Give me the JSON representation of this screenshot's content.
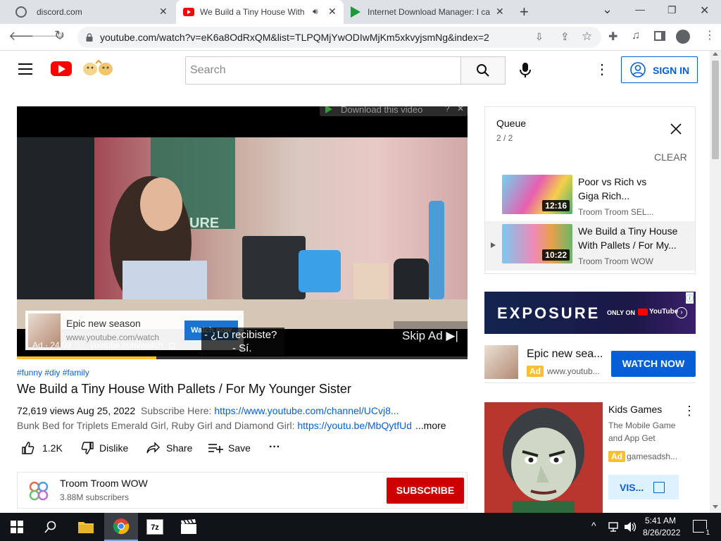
{
  "tabs": [
    {
      "title": "discord.com",
      "close": "✕"
    },
    {
      "title": "We Build a Tiny House With",
      "close": "✕"
    },
    {
      "title": "Internet Download Manager: I ca",
      "close": "✕"
    }
  ],
  "new_tab": "+",
  "window": {
    "minimize": "—",
    "restore": "❐",
    "close": "✕",
    "tablist": "⌄"
  },
  "address": {
    "url": "youtube.com/watch?v=eK6a8OdRxQM&list=TLPQMjYwODIwMjKm5xkvyjsmNg&index=2"
  },
  "yt": {
    "search_placeholder": "Search",
    "sign_in": "SIGN IN"
  },
  "idm": {
    "download_label": "Download this video",
    "help": "?",
    "close": "✕"
  },
  "ad_overlay": {
    "title": "Epic new season",
    "url": "www.youtube.com/watch",
    "cta": "Watch now"
  },
  "skip_ad": "Skip Ad ▶|",
  "player_bar": {
    "ad_time": "Ad · 24:09",
    "info": "ⓘ",
    "url": "youtube.com/watch"
  },
  "captions": [
    "- ¿Lo recibiste?",
    "- Sí."
  ],
  "progress_fraction": 0.31,
  "video_info": {
    "hashtags": "#funny #diy #family",
    "title": "We Build a Tiny House With Pallets / For My Younger Sister",
    "views_date": "72,619 views  Aug 25, 2022",
    "subscribe_here": "Subscribe Here:",
    "subscribe_link": "https://www.youtube.com/channel/UCvj8...",
    "desc": "Bunk Bed for Triplets Emerald Girl, Ruby Girl and Diamond Girl:",
    "desc_link": "https://youtu.be/MbQytfUd-",
    "more": "...more",
    "likes": "1.2K",
    "dislike": "Dislike",
    "share": "Share",
    "save": "Save",
    "more_actions": "···"
  },
  "channel": {
    "name": "Troom Troom WOW",
    "subs": "3.88M subscribers",
    "subscribe": "SUBSCRIBE"
  },
  "queue": {
    "title": "Queue",
    "position": "2 / 2",
    "clear": "CLEAR",
    "items": [
      {
        "title1": "Poor vs Rich vs",
        "title2": "Giga Rich...",
        "channel": "Troom Troom SEL...",
        "duration": "12:16"
      },
      {
        "title1": "We Build a Tiny House",
        "title2": "With Pallets / For My...",
        "channel": "Troom Troom WOW",
        "duration": "10:22"
      }
    ]
  },
  "banner_ad": {
    "brand": "EXPOSURE",
    "only_on": "ONLY ON",
    "youtube": "YouTube",
    "info": "ⓘ"
  },
  "side_ad": {
    "title": "Epic new sea...",
    "ad": "Ad",
    "url": "www.youtub...",
    "cta": "WATCH NOW"
  },
  "game_ad": {
    "title": "Kids Games",
    "desc1": "The Mobile Game",
    "desc2": "and App Get",
    "ad": "Ad",
    "url": "gamesadsh...",
    "visit": "VIS..."
  },
  "taskbar": {
    "time": "5:41 AM",
    "date": "8/26/2022",
    "notifications": "1",
    "up": "^"
  },
  "colors": {
    "yt_red": "#ff0000",
    "link": "#065fd4",
    "subscribe": "#cc0000",
    "ad_yellow": "#fbc02d",
    "taskbar": "#101418"
  }
}
